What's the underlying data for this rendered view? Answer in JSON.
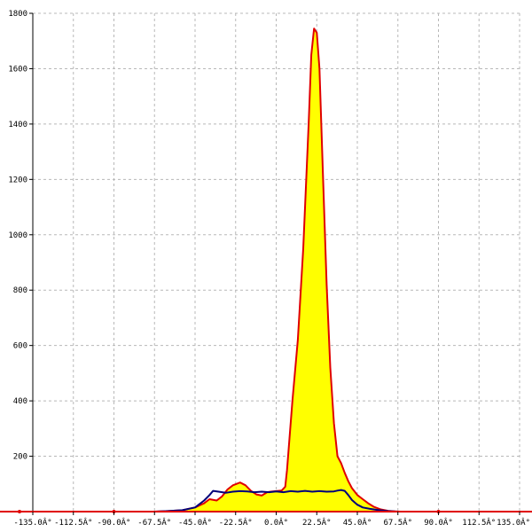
{
  "chart_data": {
    "type": "area",
    "title": "",
    "xlabel": "",
    "ylabel": "",
    "xlim": [
      -135,
      135
    ],
    "ylim": [
      0,
      1800
    ],
    "xticks": [
      -135,
      -112.5,
      -90,
      -67.5,
      -45,
      -22.5,
      0,
      22.5,
      45,
      67.5,
      90,
      112.5,
      135
    ],
    "xtick_labels": [
      "-135.0Â°",
      "-112.5Â°",
      "-90.0Â°",
      "-67.5Â°",
      "-45.0Â°",
      "-22.5Â°",
      "0.0Â°",
      "22.5Â°",
      "45.0Â°",
      "67.5Â°",
      "90.0Â°",
      "112.5Â°",
      "135.0Â°"
    ],
    "yticks": [
      200,
      400,
      600,
      800,
      1000,
      1200,
      1400,
      1600,
      1800
    ],
    "ytick_labels": [
      "200",
      "400",
      "600",
      "800",
      "1000",
      "1200",
      "1400",
      "1600",
      "1800"
    ],
    "grid": true,
    "series": [
      {
        "fill": "#ffff00",
        "color": "#e00000",
        "x": [
          -135,
          -67.5,
          -60,
          -52,
          -45,
          -40,
          -37,
          -33,
          -30,
          -27,
          -24,
          -20,
          -17,
          -14,
          -11,
          -8,
          -5,
          -3,
          0,
          3,
          5,
          6,
          9,
          12,
          15,
          18,
          19.5,
          21,
          22.5,
          24,
          26,
          28,
          30,
          32,
          34,
          36,
          38,
          40,
          42,
          45,
          48,
          51,
          54,
          58,
          62,
          66,
          69,
          75,
          90,
          135
        ],
        "y": [
          0,
          0,
          2,
          5,
          15,
          30,
          45,
          40,
          55,
          80,
          95,
          105,
          95,
          75,
          62,
          58,
          70,
          72,
          74,
          76,
          90,
          150,
          400,
          620,
          950,
          1400,
          1650,
          1745,
          1730,
          1600,
          1200,
          820,
          520,
          320,
          200,
          175,
          140,
          110,
          85,
          60,
          45,
          30,
          18,
          8,
          3,
          1,
          0,
          0,
          0,
          0
        ],
        "markers_x": [
          -90,
          90
        ],
        "markers_y": [
          0,
          0
        ]
      },
      {
        "fill": "none",
        "color": "#00007a",
        "x": [
          -135,
          -67.5,
          -60,
          -52,
          -45,
          -40,
          -37,
          -35,
          -32,
          -28,
          -24,
          -20,
          -16,
          -12,
          -8,
          -4,
          0,
          4,
          8,
          12,
          16,
          20,
          24,
          28,
          32,
          34,
          36,
          38,
          40,
          42,
          45,
          48,
          52,
          57,
          62,
          67.5,
          135
        ],
        "y": [
          0,
          0,
          2,
          5,
          15,
          40,
          60,
          75,
          72,
          68,
          72,
          74,
          73,
          70,
          72,
          70,
          73,
          70,
          74,
          72,
          75,
          72,
          74,
          72,
          73,
          76,
          78,
          75,
          60,
          42,
          25,
          15,
          10,
          5,
          2,
          0,
          0
        ]
      }
    ]
  }
}
